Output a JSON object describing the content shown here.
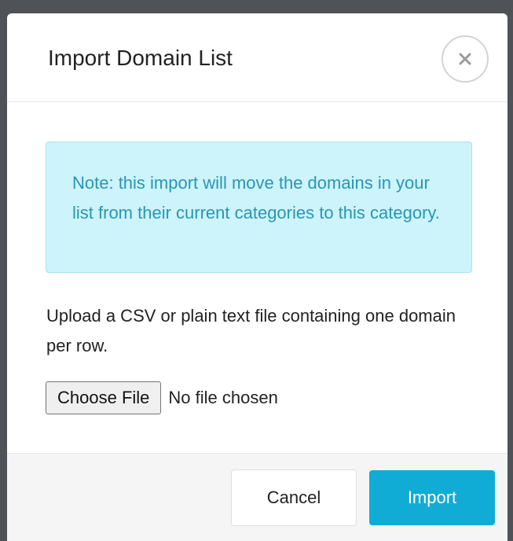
{
  "modal": {
    "title": "Import Domain List",
    "close_icon": "close-icon"
  },
  "note": {
    "text": "Note: this import will move the domains in your list from their current categories to this category."
  },
  "instructions": "Upload a CSV or plain text file containing one domain per row.",
  "file_input": {
    "button_label": "Choose File",
    "status": "No file chosen"
  },
  "footer": {
    "cancel_label": "Cancel",
    "import_label": "Import"
  },
  "colors": {
    "accent": "#10acd6",
    "note_bg": "#cdf3fb",
    "note_text": "#2996b4",
    "backdrop": "#4f5256"
  }
}
